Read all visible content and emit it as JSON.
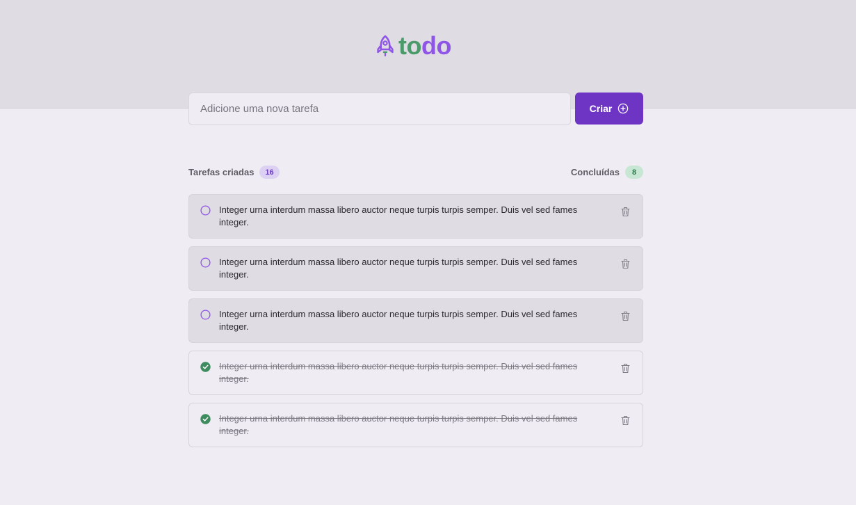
{
  "logo": {
    "part1": "to",
    "part2": "do",
    "icon": "rocket-icon"
  },
  "new_task": {
    "placeholder": "Adicione uma nova tarefa",
    "value": "",
    "button_label": "Criar",
    "button_icon": "plus-circle-icon"
  },
  "counters": {
    "created_label": "Tarefas criadas",
    "created_count": "16",
    "done_label": "Concluídas",
    "done_count": "8"
  },
  "tasks": [
    {
      "text": "Integer urna interdum massa libero auctor neque turpis turpis semper. Duis vel sed fames integer.",
      "done": false
    },
    {
      "text": "Integer urna interdum massa libero auctor neque turpis turpis semper. Duis vel sed fames integer.",
      "done": false
    },
    {
      "text": "Integer urna interdum massa libero auctor neque turpis turpis semper. Duis vel sed fames integer.",
      "done": false
    },
    {
      "text": "Integer urna interdum massa libero auctor neque turpis turpis semper. Duis vel sed fames integer.",
      "done": true
    },
    {
      "text": "Integer urna interdum massa libero auctor neque turpis turpis semper. Duis vel sed fames integer.",
      "done": true
    }
  ],
  "colors": {
    "accent_purple": "#8e55e6",
    "button_purple": "#6e35c4",
    "accent_green": "#4a9a6a",
    "check_green": "#3d8b5f"
  }
}
